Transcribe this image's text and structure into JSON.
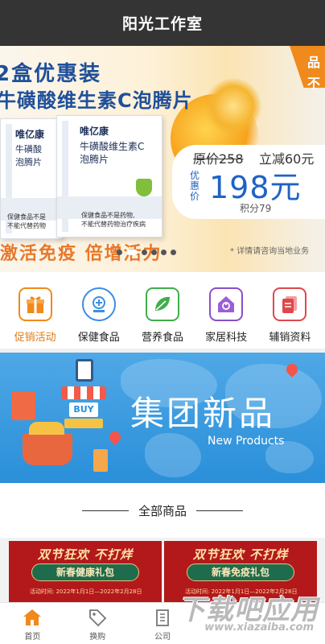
{
  "app": {
    "title": "阳光工作室"
  },
  "hero": {
    "corner_text": "品不",
    "headline_1": "2盒优惠装",
    "headline_2": "牛磺酸维生素C泡腾片",
    "box_brand": "唯亿康",
    "box_name_1": "牛磺酸维生素C",
    "box_name_2": "泡腾片",
    "box_note_1": "保健食品不是药物,",
    "box_note_2": "不能代替药物治疗疾病",
    "box1_name": "唯亿康",
    "box1_sub_1": "牛磺酸",
    "box1_sub_2": "泡腾片",
    "box1_note_1": "保健食品不是",
    "box1_note_2": "不能代替药物",
    "original_price": "原价258",
    "discount": "立减60元",
    "price_label": "优惠价",
    "price": "198元",
    "points": "积分79",
    "slogan": "激活免疫 倍增活力",
    "footnote": "* 详情请咨询当地业务",
    "carousel": {
      "count": 6,
      "active_index": 1
    }
  },
  "categories": [
    {
      "label": "促销活动",
      "icon": "gift-icon",
      "color": "#f08a1c",
      "active": true
    },
    {
      "label": "保健食品",
      "icon": "health-food-icon",
      "color": "#3a8ee6",
      "active": false
    },
    {
      "label": "营养食品",
      "icon": "leaf-icon",
      "color": "#3fae4a",
      "active": false
    },
    {
      "label": "家居科技",
      "icon": "smart-home-icon",
      "color": "#8a4fc7",
      "active": false
    },
    {
      "label": "辅销资料",
      "icon": "documents-icon",
      "color": "#e0474c",
      "active": false
    }
  ],
  "new_products": {
    "title": "集团新品",
    "subtitle": "New Products",
    "shop_sign": "BUY"
  },
  "section": {
    "title": "全部商品"
  },
  "products": [
    {
      "promo": "双节狂欢 不打烊",
      "name": "新春健康礼包",
      "period": "活动时间: 2022年1月1日—2022年2月28日"
    },
    {
      "promo": "双节狂欢 不打烊",
      "name": "新春免疫礼包",
      "period": "活动时间: 2022年1月1日—2022年2月28日"
    }
  ],
  "bottom_nav": [
    {
      "label": "首页",
      "icon": "home-icon",
      "active": true
    },
    {
      "label": "换购",
      "icon": "tag-icon",
      "active": false
    },
    {
      "label": "公司",
      "icon": "building-icon",
      "active": false
    },
    {
      "label": "",
      "icon": "",
      "active": false
    },
    {
      "label": "",
      "icon": "",
      "active": false
    }
  ],
  "watermark": {
    "main": "下载吧应用",
    "sub": "www.xiazaiba.com"
  },
  "colors": {
    "titlebar": "#343434",
    "accent_orange": "#e07a12",
    "brand_blue": "#1f63c4",
    "promo_red": "#b3191b"
  }
}
